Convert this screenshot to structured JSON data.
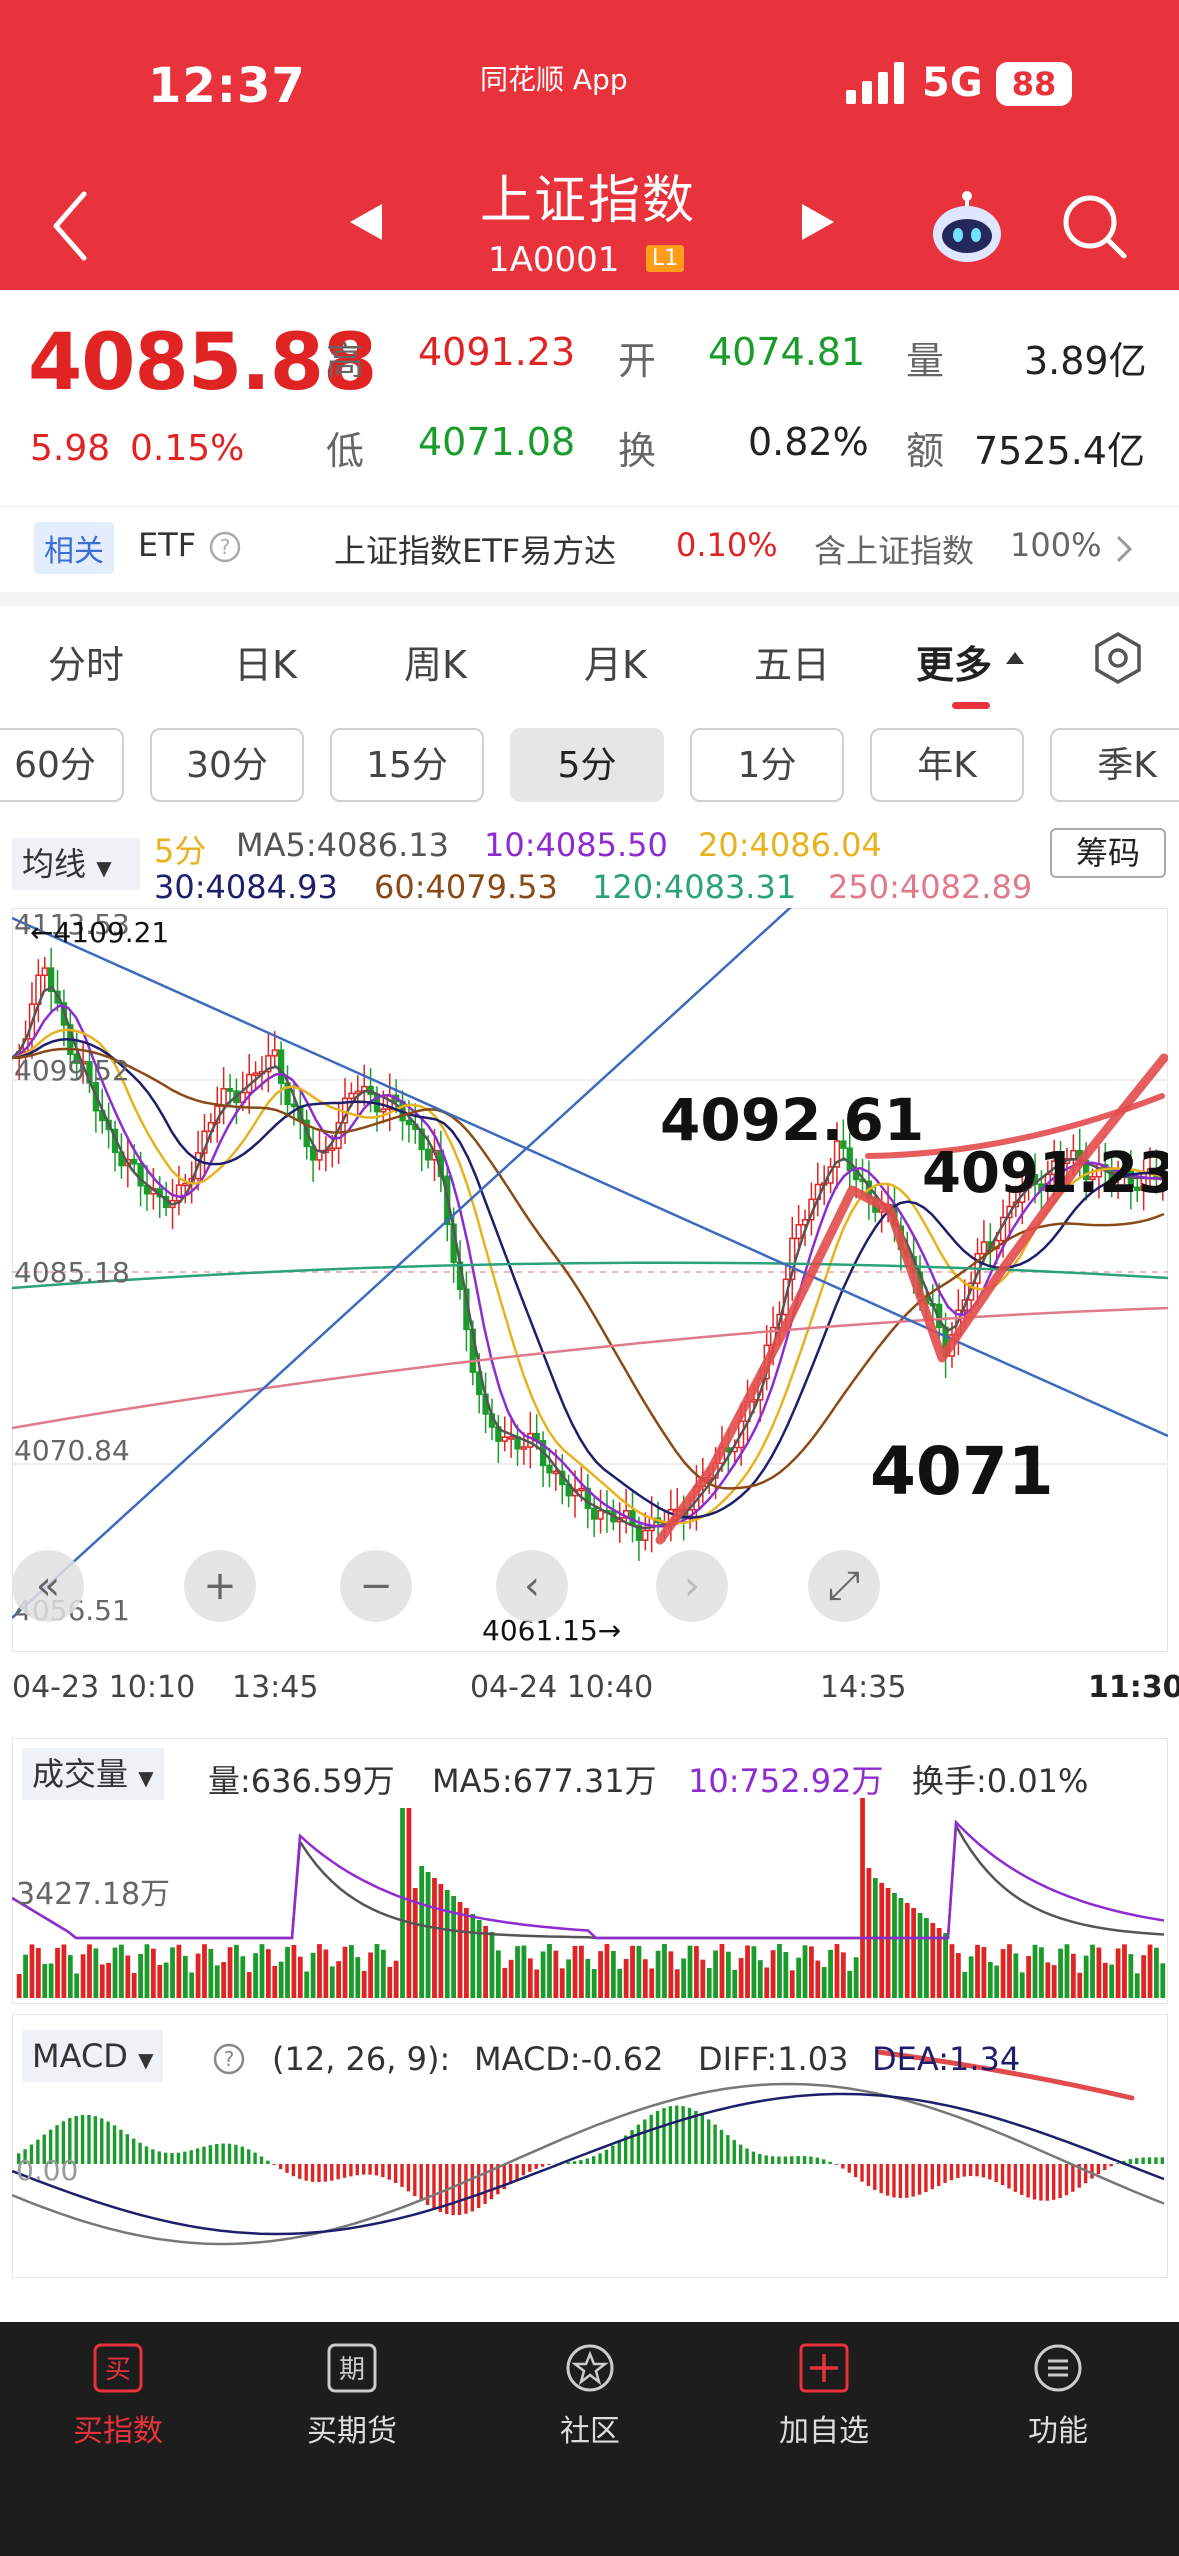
{
  "status_bar": {
    "time": "12:37",
    "app_name": "同花顺 App",
    "network": "5G",
    "battery": "88"
  },
  "header": {
    "title": "上证指数",
    "code": "1A0001",
    "level_badge": "L1"
  },
  "quote": {
    "price": "4085.88",
    "change": "5.98",
    "change_pct": "0.15%",
    "labels": {
      "high": "高",
      "open": "开",
      "volume": "量",
      "low": "低",
      "turnover": "换",
      "amount": "额"
    },
    "high": "4091.23",
    "open": "4074.81",
    "volume": "3.89亿",
    "low": "4071.08",
    "turnover": "0.82%",
    "amount": "7525.4亿"
  },
  "etf_bar": {
    "related": "相关",
    "etf": "ETF",
    "fund_name": "上证指数ETF易方达",
    "fund_change": "0.10%",
    "holding": "含上证指数",
    "holding_pct": "100%"
  },
  "period_tabs": [
    {
      "label": "分时"
    },
    {
      "label": "日K"
    },
    {
      "label": "周K"
    },
    {
      "label": "月K"
    },
    {
      "label": "五日"
    },
    {
      "label": "更多"
    }
  ],
  "minute_pills": [
    "60分",
    "30分",
    "15分",
    "5分",
    "1分",
    "年K",
    "季K"
  ],
  "ma_legend": {
    "selector": "均线",
    "period": "5分",
    "ma5": "MA5:4086.13",
    "ma10": "10:4085.50",
    "ma20": "20:4086.04",
    "ma30": "30:4084.93",
    "ma60": "60:4079.53",
    "ma120": "120:4083.31",
    "ma250": "250:4082.89",
    "chips": "筹码"
  },
  "price_axis": [
    "4113.53",
    "4099.52",
    "4085.18",
    "4070.84",
    "4056.51"
  ],
  "annotations": {
    "left_high": "←4109.21",
    "low_mark": "4061.15→",
    "peak1": "4092.61",
    "peak2": "4091.23",
    "bottom": "4071"
  },
  "time_axis": [
    "04-23 10:10",
    "13:45",
    "04-24 10:40",
    "14:35",
    "11:30"
  ],
  "volume": {
    "selector": "成交量",
    "vol": "量:636.59万",
    "ma5": "MA5:677.31万",
    "ma10": "10:752.92万",
    "turnover": "换手:0.01%",
    "axis_label": "3427.18万"
  },
  "macd": {
    "selector": "MACD",
    "params": "(12, 26, 9):",
    "macd": "MACD:-0.62",
    "diff": "DIFF:1.03",
    "dea": "DEA:1.34",
    "axis_label": "0.00"
  },
  "colors": {
    "brand": "#e8323c",
    "up": "#e02424",
    "down": "#1a9c2b",
    "ma5": "#555555",
    "ma10": "#8e2bd1",
    "ma20": "#e8b21e",
    "ma30": "#1d1f6b",
    "ma60": "#8a4a15",
    "ma120": "#2aa27a",
    "ma250": "#e07a8a"
  },
  "bottom_nav": [
    {
      "label": "买指数",
      "icon": "buy-icon"
    },
    {
      "label": "买期货",
      "icon": "futures-icon"
    },
    {
      "label": "社区",
      "icon": "community-icon"
    },
    {
      "label": "加自选",
      "icon": "add-watchlist-icon"
    },
    {
      "label": "功能",
      "icon": "menu-icon"
    }
  ]
}
